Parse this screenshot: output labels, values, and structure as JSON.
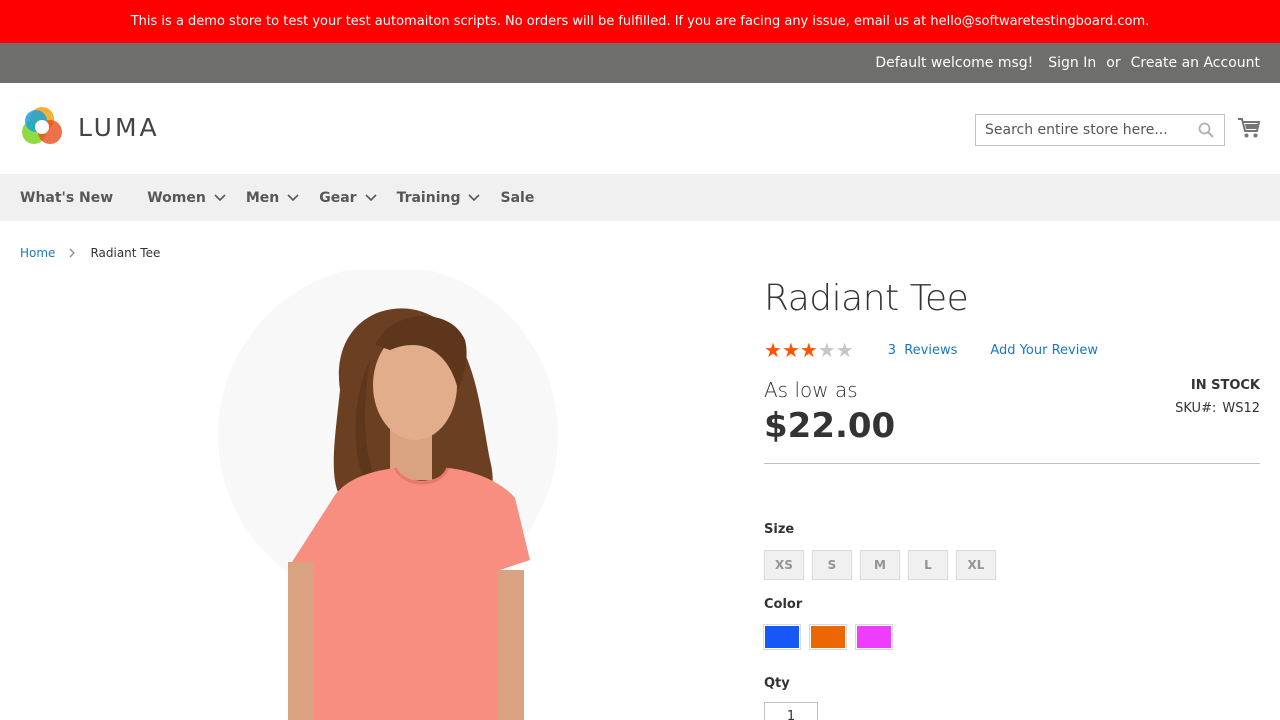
{
  "banner": {
    "text": "This is a demo store to test your test automaiton scripts. No orders will be fulfilled. If you are facing any issue, email us at hello@softwaretestingboard.com."
  },
  "top_bar": {
    "welcome": "Default welcome msg!",
    "sign_in": "Sign In",
    "or": "or",
    "create_account": "Create an Account"
  },
  "header": {
    "logo_text": "LUMA",
    "search_placeholder": "Search entire store here..."
  },
  "nav": {
    "items": [
      {
        "label": "What's New",
        "dropdown": false
      },
      {
        "label": "Women",
        "dropdown": true
      },
      {
        "label": "Men",
        "dropdown": true
      },
      {
        "label": "Gear",
        "dropdown": true
      },
      {
        "label": "Training",
        "dropdown": true
      },
      {
        "label": "Sale",
        "dropdown": false
      }
    ]
  },
  "breadcrumb": {
    "home": "Home",
    "current": "Radiant Tee"
  },
  "product": {
    "title": "Radiant Tee",
    "rating": 3,
    "rating_max": 5,
    "reviews_count": "3",
    "reviews_label": "Reviews",
    "add_review": "Add Your Review",
    "as_low_as": "As low as",
    "price": "$22.00",
    "stock": "IN STOCK",
    "sku_label": "SKU#:",
    "sku": "WS12",
    "size_label": "Size",
    "sizes": [
      "XS",
      "S",
      "M",
      "L",
      "XL"
    ],
    "color_label": "Color",
    "colors": [
      "#1857f7",
      "#eb6703",
      "#ef3dff"
    ],
    "qty_label": "Qty",
    "qty_value": "1"
  },
  "theme": {
    "banner_color": "#ff0000",
    "top_bar_color": "#6e6e6c",
    "link_color": "#1979c3",
    "star_color": "#ff5501"
  }
}
